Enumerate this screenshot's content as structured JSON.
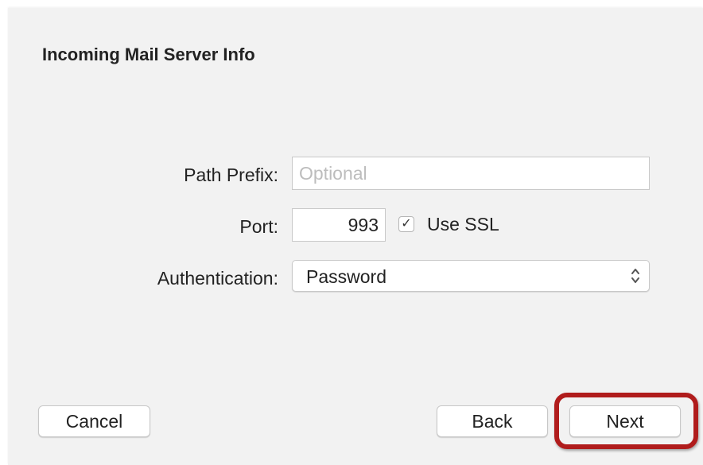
{
  "dialog": {
    "title": "Incoming Mail Server Info"
  },
  "form": {
    "path_prefix": {
      "label": "Path Prefix:",
      "value": "",
      "placeholder": "Optional"
    },
    "port": {
      "label": "Port:",
      "value": "993"
    },
    "use_ssl": {
      "label": "Use SSL",
      "checked": true,
      "check_glyph": "✓"
    },
    "authentication": {
      "label": "Authentication:",
      "selected": "Password"
    }
  },
  "buttons": {
    "cancel": "Cancel",
    "back": "Back",
    "next": "Next"
  },
  "highlight": {
    "target": "next-button",
    "color": "#b01c1c"
  }
}
